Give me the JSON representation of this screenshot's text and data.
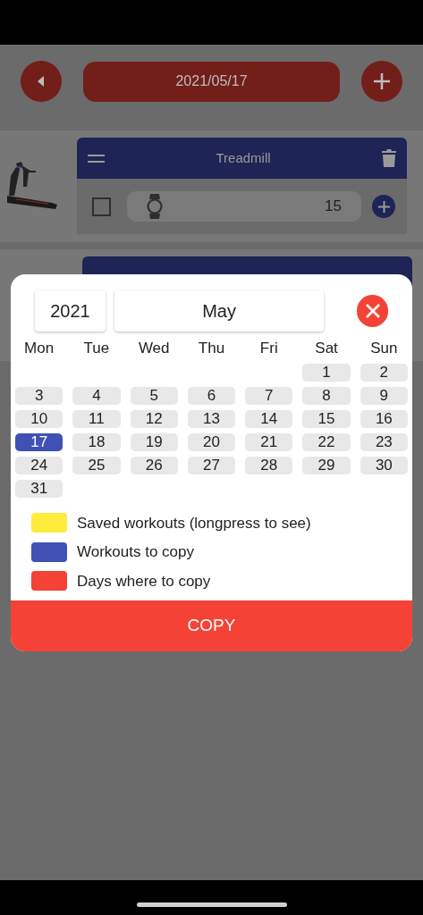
{
  "header": {
    "date": "2021/05/17"
  },
  "workouts": [
    {
      "title": "Treadmill",
      "checked": false,
      "value": "15"
    }
  ],
  "calendar": {
    "year": "2021",
    "month": "May",
    "weekdays": [
      "Mon",
      "Tue",
      "Wed",
      "Thu",
      "Fri",
      "Sat",
      "Sun"
    ],
    "days": [
      {
        "label": "1",
        "selected": false
      },
      {
        "label": "2",
        "selected": false
      },
      {
        "label": "3",
        "selected": false
      },
      {
        "label": "4",
        "selected": false
      },
      {
        "label": "5",
        "selected": false
      },
      {
        "label": "6",
        "selected": false
      },
      {
        "label": "7",
        "selected": false
      },
      {
        "label": "8",
        "selected": false
      },
      {
        "label": "9",
        "selected": false
      },
      {
        "label": "10",
        "selected": false
      },
      {
        "label": "11",
        "selected": false
      },
      {
        "label": "12",
        "selected": false
      },
      {
        "label": "13",
        "selected": false
      },
      {
        "label": "14",
        "selected": false
      },
      {
        "label": "15",
        "selected": false
      },
      {
        "label": "16",
        "selected": false
      },
      {
        "label": "17",
        "selected": true
      },
      {
        "label": "18",
        "selected": false
      },
      {
        "label": "19",
        "selected": false
      },
      {
        "label": "20",
        "selected": false
      },
      {
        "label": "21",
        "selected": false
      },
      {
        "label": "22",
        "selected": false
      },
      {
        "label": "23",
        "selected": false
      },
      {
        "label": "24",
        "selected": false
      },
      {
        "label": "25",
        "selected": false
      },
      {
        "label": "26",
        "selected": false
      },
      {
        "label": "27",
        "selected": false
      },
      {
        "label": "28",
        "selected": false
      },
      {
        "label": "29",
        "selected": false
      },
      {
        "label": "30",
        "selected": false
      },
      {
        "label": "31",
        "selected": false
      }
    ]
  },
  "legend": [
    {
      "label": "Saved workouts (longpress to see)",
      "color": "#ffeb3b"
    },
    {
      "label": "Workouts to copy",
      "color": "#3f51b5"
    },
    {
      "label": "Days where to copy",
      "color": "#f44336"
    }
  ],
  "copy_button": "COPY"
}
